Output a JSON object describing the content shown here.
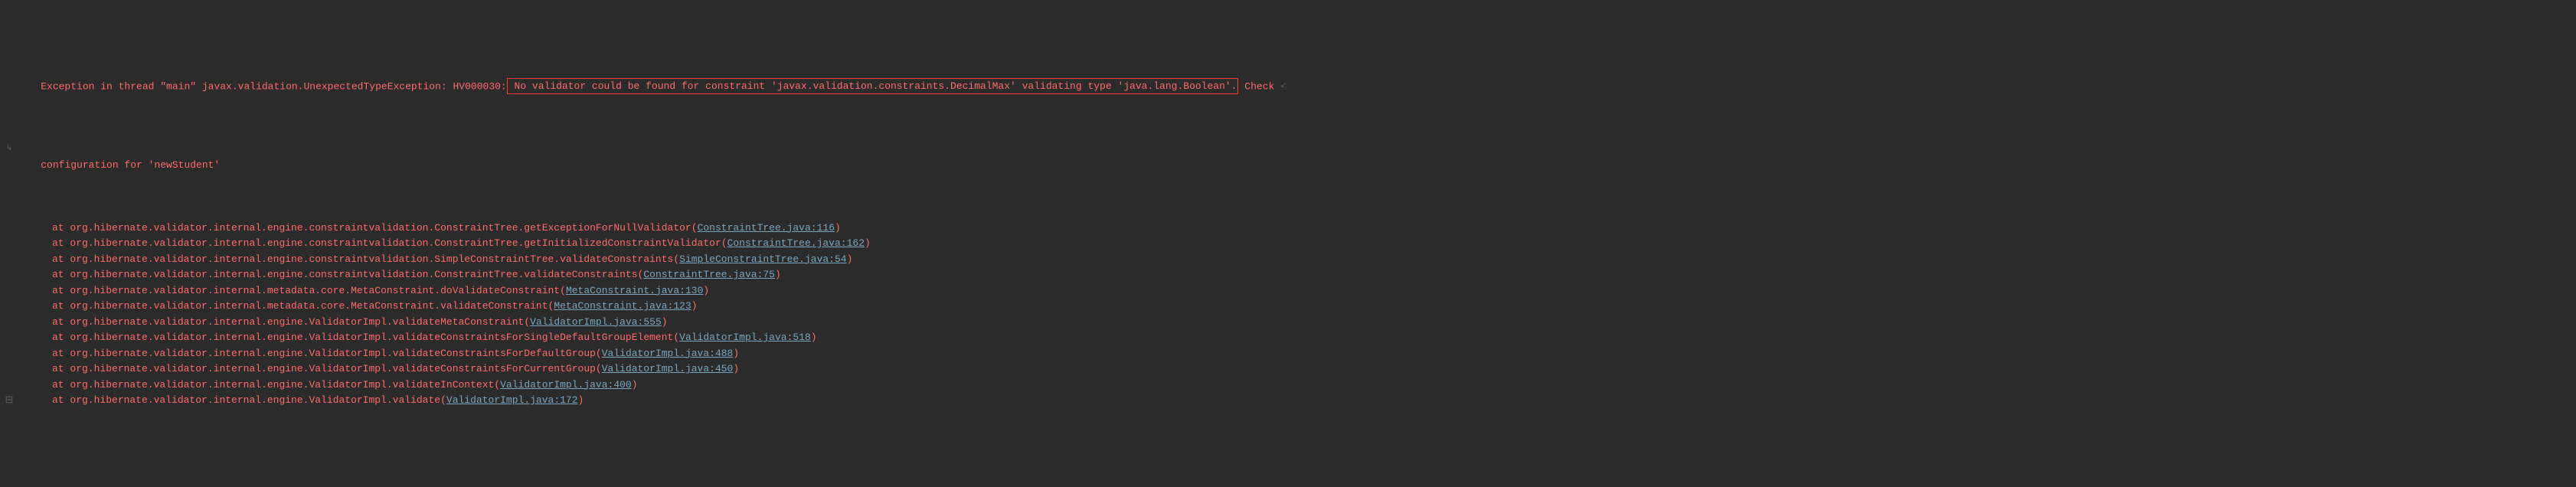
{
  "exception": {
    "prefix1": "Exception in thread \"main\" javax.validation.UnexpectedTypeException: HV000030:",
    "highlighted": " No validator could be found for constraint 'javax.validation.constraints.DecimalMax' validating type 'java.lang.Boolean'.",
    "suffix1": " Check ",
    "cont_prefix": "configuration for 'newStudent'"
  },
  "icons": {
    "wrap": "↙",
    "continuation": "↳",
    "marker": "⊟"
  },
  "trace": [
    {
      "at": "at ",
      "pkg": "org.hibernate.validator.internal.engine.constraintvalidation.ConstraintTree.getExceptionForNullValidator",
      "file": "ConstraintTree.java:116"
    },
    {
      "at": "at ",
      "pkg": "org.hibernate.validator.internal.engine.constraintvalidation.ConstraintTree.getInitializedConstraintValidator",
      "file": "ConstraintTree.java:162"
    },
    {
      "at": "at ",
      "pkg": "org.hibernate.validator.internal.engine.constraintvalidation.SimpleConstraintTree.validateConstraints",
      "file": "SimpleConstraintTree.java:54"
    },
    {
      "at": "at ",
      "pkg": "org.hibernate.validator.internal.engine.constraintvalidation.ConstraintTree.validateConstraints",
      "file": "ConstraintTree.java:75"
    },
    {
      "at": "at ",
      "pkg": "org.hibernate.validator.internal.metadata.core.MetaConstraint.doValidateConstraint",
      "file": "MetaConstraint.java:130"
    },
    {
      "at": "at ",
      "pkg": "org.hibernate.validator.internal.metadata.core.MetaConstraint.validateConstraint",
      "file": "MetaConstraint.java:123"
    },
    {
      "at": "at ",
      "pkg": "org.hibernate.validator.internal.engine.ValidatorImpl.validateMetaConstraint",
      "file": "ValidatorImpl.java:555"
    },
    {
      "at": "at ",
      "pkg": "org.hibernate.validator.internal.engine.ValidatorImpl.validateConstraintsForSingleDefaultGroupElement",
      "file": "ValidatorImpl.java:518"
    },
    {
      "at": "at ",
      "pkg": "org.hibernate.validator.internal.engine.ValidatorImpl.validateConstraintsForDefaultGroup",
      "file": "ValidatorImpl.java:488"
    },
    {
      "at": "at ",
      "pkg": "org.hibernate.validator.internal.engine.ValidatorImpl.validateConstraintsForCurrentGroup",
      "file": "ValidatorImpl.java:450"
    },
    {
      "at": "at ",
      "pkg": "org.hibernate.validator.internal.engine.ValidatorImpl.validateInContext",
      "file": "ValidatorImpl.java:400"
    },
    {
      "at": "at ",
      "pkg": "org.hibernate.validator.internal.engine.ValidatorImpl.validate",
      "file": "ValidatorImpl.java:172"
    }
  ],
  "paren_open": "(",
  "paren_close": ")"
}
